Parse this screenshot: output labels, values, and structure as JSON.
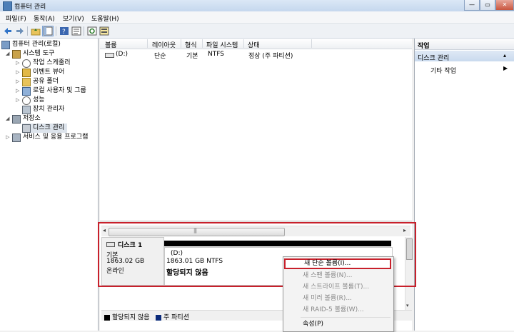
{
  "window": {
    "title": "컴퓨터 관리"
  },
  "menu": [
    "파일(F)",
    "동작(A)",
    "보기(V)",
    "도움말(H)"
  ],
  "tree": {
    "root": "컴퓨터 관리(로컬)",
    "system_tools": "시스템 도구",
    "task_scheduler": "작업 스케줄러",
    "event_viewer": "이벤트 뷰어",
    "shared_folders": "공유 폴더",
    "local_users": "로컬 사용자 및 그룹",
    "performance": "성능",
    "device_manager": "장치 관리자",
    "storage": "저장소",
    "disk_management": "디스크 관리",
    "services_apps": "서비스 및 응용 프로그램"
  },
  "list": {
    "headers": [
      "볼륨",
      "레이아웃",
      "형식",
      "파일 시스템",
      "상태"
    ],
    "row": [
      "(D:)",
      "단순",
      "기본",
      "NTFS",
      "정상 (주 파티션)"
    ]
  },
  "disk": {
    "name": "디스크 1",
    "type": "기본",
    "size": "1863.02 GB",
    "status": "온라인",
    "volume_name": "(D:)",
    "volume_size": "1863.01 GB NTFS",
    "volume_status": "할당되지 않음"
  },
  "legend": {
    "unallocated": "할당되지 않음",
    "primary": "주 파티션"
  },
  "context_menu": [
    {
      "label": "새 단순 볼륨(I)...",
      "enabled": true
    },
    {
      "label": "새 스팬 볼륨(N)...",
      "enabled": false
    },
    {
      "label": "새 스트라이프 볼륨(T)...",
      "enabled": false
    },
    {
      "label": "새 미러 볼륨(R)...",
      "enabled": false
    },
    {
      "label": "새 RAID-5 볼륨(W)...",
      "enabled": false
    },
    {
      "label": "속성(P)",
      "enabled": true
    }
  ],
  "actions": {
    "title": "작업",
    "section": "디스크 관리",
    "more": "기타 작업"
  },
  "colors": {
    "unallocated": "#000000",
    "primary": "#0a2a7a",
    "highlight": "#c8202b"
  }
}
